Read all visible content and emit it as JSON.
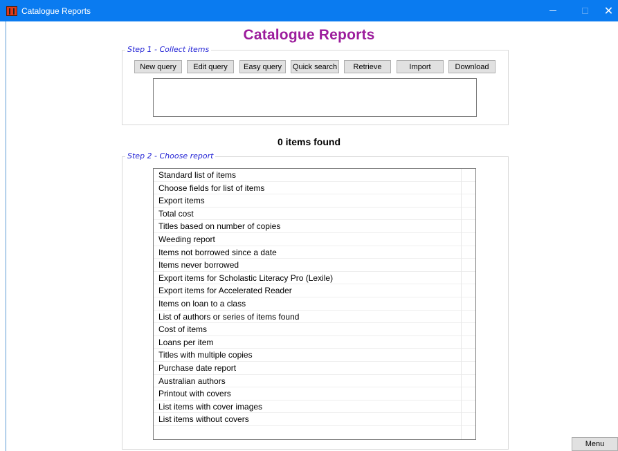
{
  "window": {
    "title": "Catalogue Reports",
    "minimize_glyph": "—",
    "close_glyph": "✕"
  },
  "page": {
    "heading": "Catalogue Reports"
  },
  "step1": {
    "legend": "Step 1 - Collect items",
    "buttons": [
      "New query",
      "Edit query",
      "Easy query",
      "Quick search",
      "Retrieve",
      "Import",
      "Download"
    ]
  },
  "status": {
    "found": "0 items found"
  },
  "step2": {
    "legend": "Step 2 - Choose report",
    "reports": [
      "Standard list of items",
      "Choose fields for list of items",
      "Export items",
      "Total cost",
      "Titles based on number of copies",
      "Weeding report",
      "Items not borrowed since a date",
      "Items never borrowed",
      "Export items for Scholastic Literacy Pro (Lexile)",
      "Export items for Accelerated Reader",
      "Items on loan to a class",
      "List of authors or series of items found",
      "Cost of items",
      "Loans per item",
      "Titles with multiple copies",
      "Purchase date report",
      "Australian authors",
      "Printout with covers",
      "List items with cover images",
      "List items without covers"
    ]
  },
  "footer": {
    "menu_label": "Menu"
  },
  "colors": {
    "titlebar": "#0a7bf0",
    "heading": "#9c1c9c",
    "legend": "#1f1fd4"
  }
}
